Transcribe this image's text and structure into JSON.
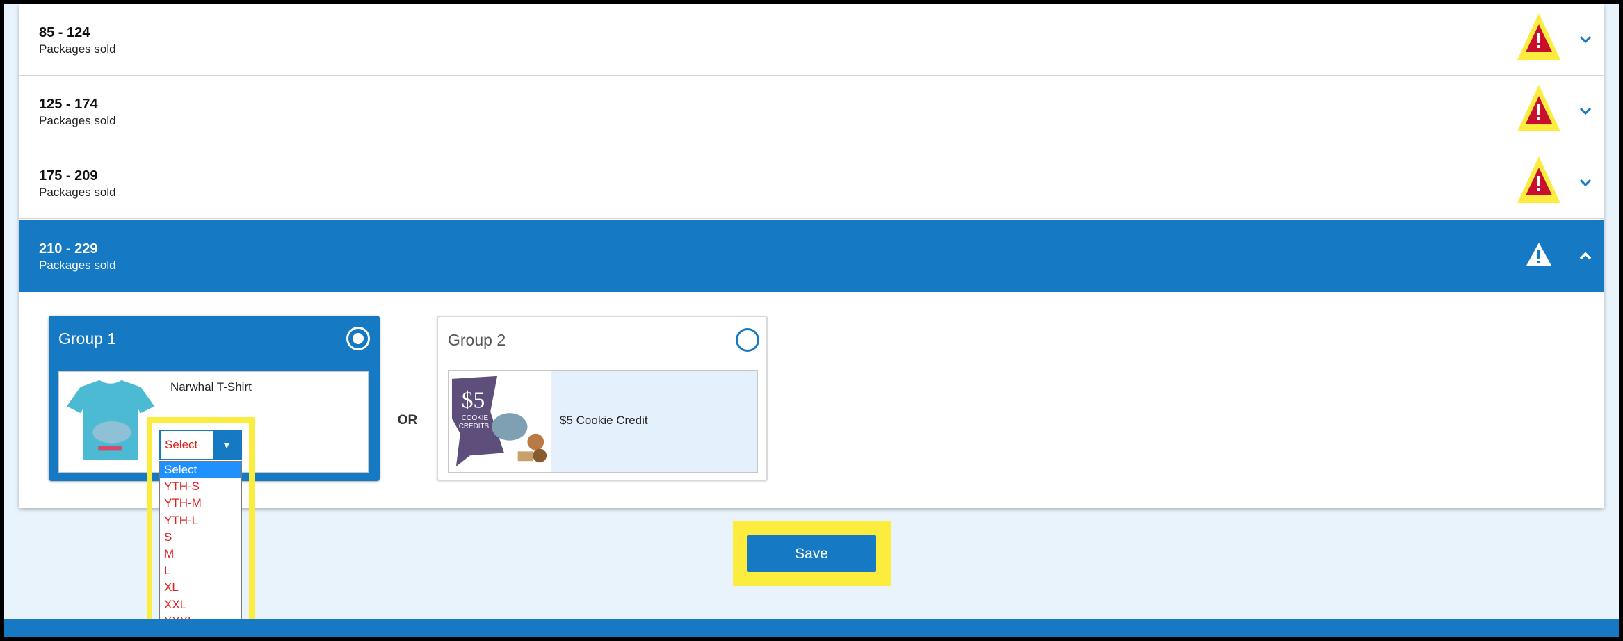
{
  "tiers": [
    {
      "range": "85 - 124",
      "sub": "Packages sold"
    },
    {
      "range": "125 - 174",
      "sub": "Packages sold"
    },
    {
      "range": "175 - 209",
      "sub": "Packages sold"
    },
    {
      "range": "210 - 229",
      "sub": "Packages sold"
    }
  ],
  "group1": {
    "title": "Group 1",
    "product_name": "Narwhal T-Shirt",
    "select_value": "Select",
    "options": [
      "Select",
      "YTH-S",
      "YTH-M",
      "YTH-L",
      "S",
      "M",
      "L",
      "XL",
      "XXL",
      "XXXL"
    ]
  },
  "or_label": "OR",
  "group2": {
    "title": "Group 2",
    "product_name": "$5 Cookie Credit",
    "thumb_text": "$5",
    "thumb_caption_1": "COOKIE",
    "thumb_caption_2": "CREDITS"
  },
  "save_label": "Save",
  "colors": {
    "primary": "#1579c4",
    "highlight": "#fbec3e",
    "warn_red": "#c8102e",
    "option_text": "#e21f1f",
    "background": "#e9f3fc"
  },
  "icons": {
    "warning": "warning-triangle-icon",
    "chevron_down": "chevron-down-icon",
    "chevron_up": "chevron-up-icon"
  }
}
